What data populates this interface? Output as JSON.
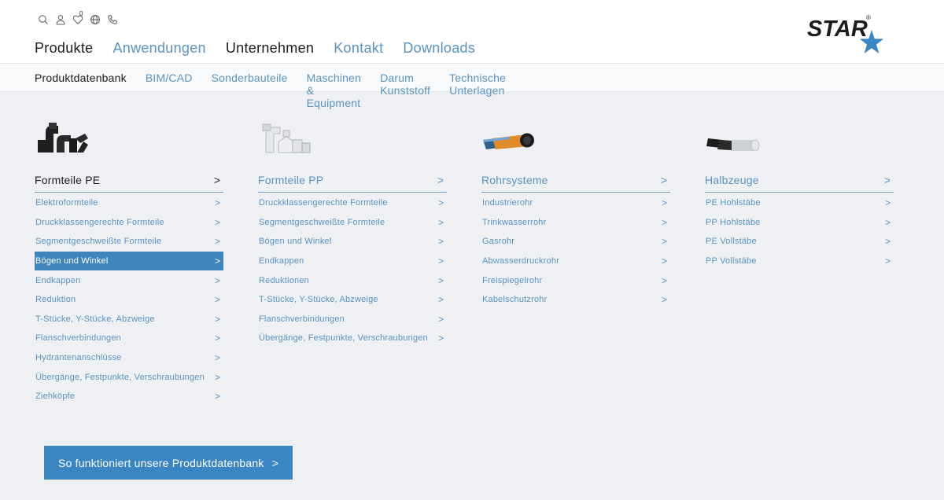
{
  "colors": {
    "accent": "#5a93c1",
    "active_bg": "#3e84bd",
    "cta_bg": "#3a86c2",
    "logo_star": "#3a86c2"
  },
  "utility_icons": [
    "search-icon",
    "user-icon",
    "heart-icon",
    "globe-icon",
    "phone-icon"
  ],
  "utility_badge": "0",
  "logo": {
    "text": "STAR",
    "registered": "®"
  },
  "main_nav": [
    {
      "label": "Produkte"
    },
    {
      "label": "Anwendungen"
    },
    {
      "label": "Unternehmen"
    },
    {
      "label": "Kontakt"
    },
    {
      "label": "Downloads"
    }
  ],
  "sub_nav": [
    {
      "label": "Produktdatenbank"
    },
    {
      "label": "BIM/CAD"
    },
    {
      "label": "Sonderbauteile"
    },
    {
      "label": "Maschinen & Equipment"
    },
    {
      "label": "Darum Kunststoff"
    },
    {
      "label": "Technische Unterlagen"
    }
  ],
  "columns": [
    {
      "title": "Formteile PE",
      "items": [
        "Elektroformteile",
        "Druckklassengerechte Formteile",
        "Segmentgeschweißte Formteile",
        "Bögen und Winkel",
        "Endkappen",
        "Reduktion",
        "T-Stücke, Y-Stücke, Abzweige",
        "Flanschverbindungen",
        "Hydrantenanschlüsse",
        "Übergänge, Festpunkte, Verschraubungen",
        "Ziehköpfe"
      ]
    },
    {
      "title": "Formteile PP",
      "items": [
        "Druckklassengerechte Formteile",
        "Segmentgeschweißte Formteile",
        "Bögen und Winkel",
        "Endkappen",
        "Reduktionen",
        "T-Stücke, Y-Stücke, Abzweige",
        "Flanschverbindungen",
        "Übergänge, Festpunkte, Verschraubungen"
      ]
    },
    {
      "title": "Rohrsysteme",
      "items": [
        "Industrierohr",
        "Trinkwasserrohr",
        "Gasrohr",
        "Abwasserdruckrohr",
        "Freispiegelrohr",
        "Kabelschutzrohr"
      ]
    },
    {
      "title": "Halbzeuge",
      "items": [
        "PE Hohlstäbe",
        "PP Hohlstäbe",
        "PE Vollstäbe",
        "PP Vollstäbe"
      ]
    }
  ],
  "cta_label": "So funktioniert unsere Produktdatenbank"
}
